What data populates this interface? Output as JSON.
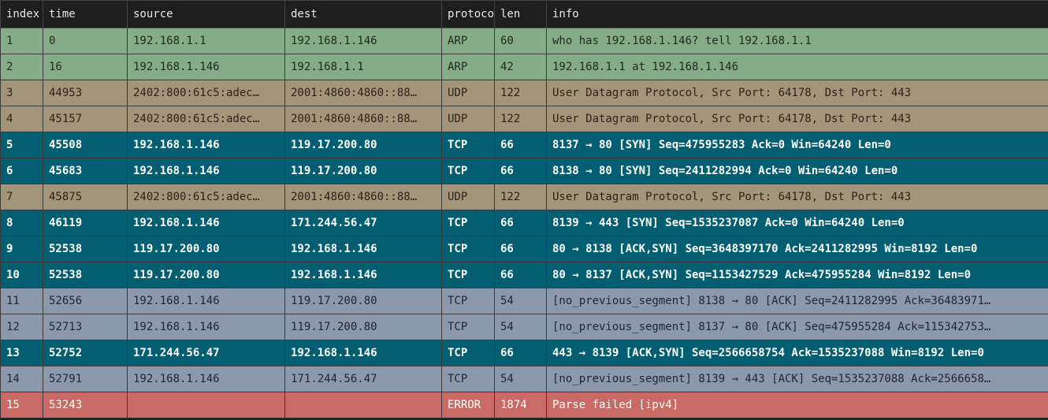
{
  "columns": [
    "index",
    "time",
    "source",
    "dest",
    "protocol",
    "len",
    "info"
  ],
  "rows": [
    {
      "index": "1",
      "time": "0",
      "source": "192.168.1.1",
      "dest": "192.168.1.146",
      "protocol": "ARP",
      "len": "60",
      "info": "who has 192.168.1.146? tell 192.168.1.1",
      "style": "arp"
    },
    {
      "index": "2",
      "time": "16",
      "source": "192.168.1.146",
      "dest": "192.168.1.1",
      "protocol": "ARP",
      "len": "42",
      "info": "192.168.1.1 at 192.168.1.146",
      "style": "arp"
    },
    {
      "index": "3",
      "time": "44953",
      "source": "2402:800:61c5:adec…",
      "dest": "2001:4860:4860::88…",
      "protocol": "UDP",
      "len": "122",
      "info": "User Datagram Protocol, Src Port: 64178, Dst Port: 443",
      "style": "udp"
    },
    {
      "index": "4",
      "time": "45157",
      "source": "2402:800:61c5:adec…",
      "dest": "2001:4860:4860::88…",
      "protocol": "UDP",
      "len": "122",
      "info": "User Datagram Protocol, Src Port: 64178, Dst Port: 443",
      "style": "udp"
    },
    {
      "index": "5",
      "time": "45508",
      "source": "192.168.1.146",
      "dest": "119.17.200.80",
      "protocol": "TCP",
      "len": "66",
      "info": "8137 → 80 [SYN] Seq=475955283 Ack=0 Win=64240 Len=0",
      "style": "tcp-hi"
    },
    {
      "index": "6",
      "time": "45683",
      "source": "192.168.1.146",
      "dest": "119.17.200.80",
      "protocol": "TCP",
      "len": "66",
      "info": "8138 → 80 [SYN] Seq=2411282994 Ack=0 Win=64240 Len=0",
      "style": "tcp-hi"
    },
    {
      "index": "7",
      "time": "45875",
      "source": "2402:800:61c5:adec…",
      "dest": "2001:4860:4860::88…",
      "protocol": "UDP",
      "len": "122",
      "info": "User Datagram Protocol, Src Port: 64178, Dst Port: 443",
      "style": "udp"
    },
    {
      "index": "8",
      "time": "46119",
      "source": "192.168.1.146",
      "dest": "171.244.56.47",
      "protocol": "TCP",
      "len": "66",
      "info": "8139 → 443 [SYN] Seq=1535237087 Ack=0 Win=64240 Len=0",
      "style": "tcp-hi"
    },
    {
      "index": "9",
      "time": "52538",
      "source": "119.17.200.80",
      "dest": "192.168.1.146",
      "protocol": "TCP",
      "len": "66",
      "info": "80 → 8138 [ACK,SYN] Seq=3648397170 Ack=2411282995 Win=8192 Len=0",
      "style": "tcp-hi"
    },
    {
      "index": "10",
      "time": "52538",
      "source": "119.17.200.80",
      "dest": "192.168.1.146",
      "protocol": "TCP",
      "len": "66",
      "info": "80 → 8137 [ACK,SYN] Seq=1153427529 Ack=475955284 Win=8192 Len=0",
      "style": "tcp-hi"
    },
    {
      "index": "11",
      "time": "52656",
      "source": "192.168.1.146",
      "dest": "119.17.200.80",
      "protocol": "TCP",
      "len": "54",
      "info": "[no_previous_segment] 8138 → 80 [ACK] Seq=2411282995 Ack=36483971…",
      "style": "tcp-lo"
    },
    {
      "index": "12",
      "time": "52713",
      "source": "192.168.1.146",
      "dest": "119.17.200.80",
      "protocol": "TCP",
      "len": "54",
      "info": "[no_previous_segment] 8137 → 80 [ACK] Seq=475955284 Ack=115342753…",
      "style": "tcp-lo"
    },
    {
      "index": "13",
      "time": "52752",
      "source": "171.244.56.47",
      "dest": "192.168.1.146",
      "protocol": "TCP",
      "len": "66",
      "info": "443 → 8139 [ACK,SYN] Seq=2566658754 Ack=1535237088 Win=8192 Len=0",
      "style": "tcp-hi"
    },
    {
      "index": "14",
      "time": "52791",
      "source": "192.168.1.146",
      "dest": "171.244.56.47",
      "protocol": "TCP",
      "len": "54",
      "info": "[no_previous_segment] 8139 → 443 [ACK] Seq=1535237088 Ack=2566658…",
      "style": "tcp-lo"
    },
    {
      "index": "15",
      "time": "53243",
      "source": "",
      "dest": "",
      "protocol": "ERROR",
      "len": "1874",
      "info": "Parse failed [ipv4]",
      "style": "error"
    }
  ]
}
